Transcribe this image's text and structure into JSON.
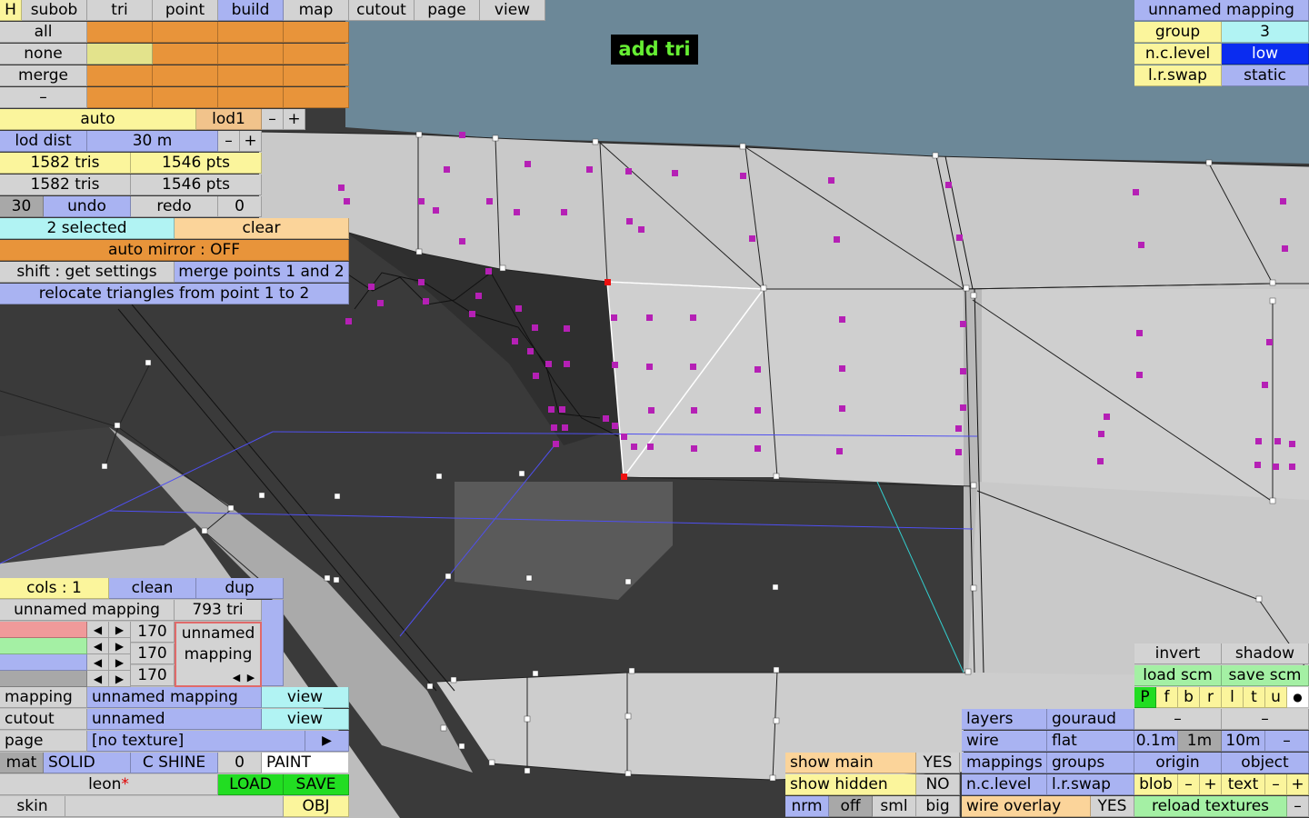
{
  "menu": {
    "h": "H",
    "items": [
      "subob",
      "tri",
      "point",
      "build",
      "map",
      "cutout",
      "page",
      "view"
    ],
    "active": "build"
  },
  "overlay_label": "add tri",
  "select_panel": {
    "all": "all",
    "none": "none",
    "merge": "merge",
    "dash": "–",
    "auto": "auto",
    "lod1": "lod1",
    "minus": "–",
    "plus": "+",
    "lod_dist_label": "lod dist",
    "lod_dist_value": "30 m",
    "tris_1": "1582 tris",
    "pts_1": "1546 pts",
    "tris_2": "1582 tris",
    "pts_2": "1546 pts",
    "thirty": "30",
    "undo": "undo",
    "redo": "redo",
    "zero": "0",
    "selected": "2 selected",
    "clear": "clear",
    "auto_mirror": "auto mirror : OFF",
    "shift_settings": "shift : get settings",
    "merge_points": "merge points 1 and 2",
    "relocate": "relocate triangles from point 1 to 2"
  },
  "mapping_panel": {
    "title": "unnamed mapping",
    "group_label": "group",
    "group_value": "3",
    "nclevel_label": "n.c.level",
    "nclevel_value": "low",
    "lrswap_label": "l.r.swap",
    "lrswap_value": "static"
  },
  "color_panel": {
    "cols": "cols : 1",
    "clean": "clean",
    "dup": "dup",
    "mapping_name": "unnamed mapping",
    "tri_count": "793 tri",
    "r": "170",
    "g": "170",
    "b": "170",
    "preview_line1": "unnamed",
    "preview_line2": "mapping",
    "colors": {
      "red": "#f09a9a",
      "green": "#a4f0a4",
      "blue": "#a9b3f2",
      "gray": "#a8a8a8"
    }
  },
  "bottom_left": {
    "mapping_label": "mapping",
    "mapping_value": "unnamed mapping",
    "view1": "view",
    "cutout_label": "cutout",
    "cutout_value": "unnamed",
    "view2": "view",
    "page_label": "page",
    "page_value": "[no texture]",
    "play": "▶",
    "mat": "mat",
    "solid": "SOLID",
    "cshine": "C SHINE",
    "zero": "0",
    "paint": "PAINT",
    "leon": "leon",
    "star": "*",
    "load": "LOAD",
    "save": "SAVE",
    "skin": "skin",
    "obj": "OBJ"
  },
  "bottom_mid": {
    "show_main": "show main",
    "yes1": "YES",
    "show_hidden": "show hidden",
    "no": "NO",
    "nrm": "nrm",
    "off": "off",
    "sml": "sml",
    "big": "big"
  },
  "bottom_right": {
    "layers": "layers",
    "gouraud": "gouraud",
    "wire": "wire",
    "flat": "flat",
    "mappings": "mappings",
    "groups": "groups",
    "nclevel": "n.c.level",
    "lrswap": "l.r.swap",
    "wire_overlay": "wire overlay",
    "yes2": "YES",
    "invert": "invert",
    "shadow": "shadow",
    "load_scm": "load scm",
    "save_scm": "save scm",
    "letters": [
      "P",
      "f",
      "b",
      "r",
      "l",
      "t",
      "u",
      "●"
    ],
    "dash1": "–",
    "dash2": "–",
    "s01": "0.1m",
    "s1": "1m",
    "s10": "10m",
    "sminus": "–",
    "origin": "origin",
    "object": "object",
    "blob": "blob",
    "bminus": "–",
    "bplus": "+",
    "text": "text",
    "tminus": "–",
    "tplus": "+",
    "reload": "reload textures",
    "rminus": "–"
  }
}
